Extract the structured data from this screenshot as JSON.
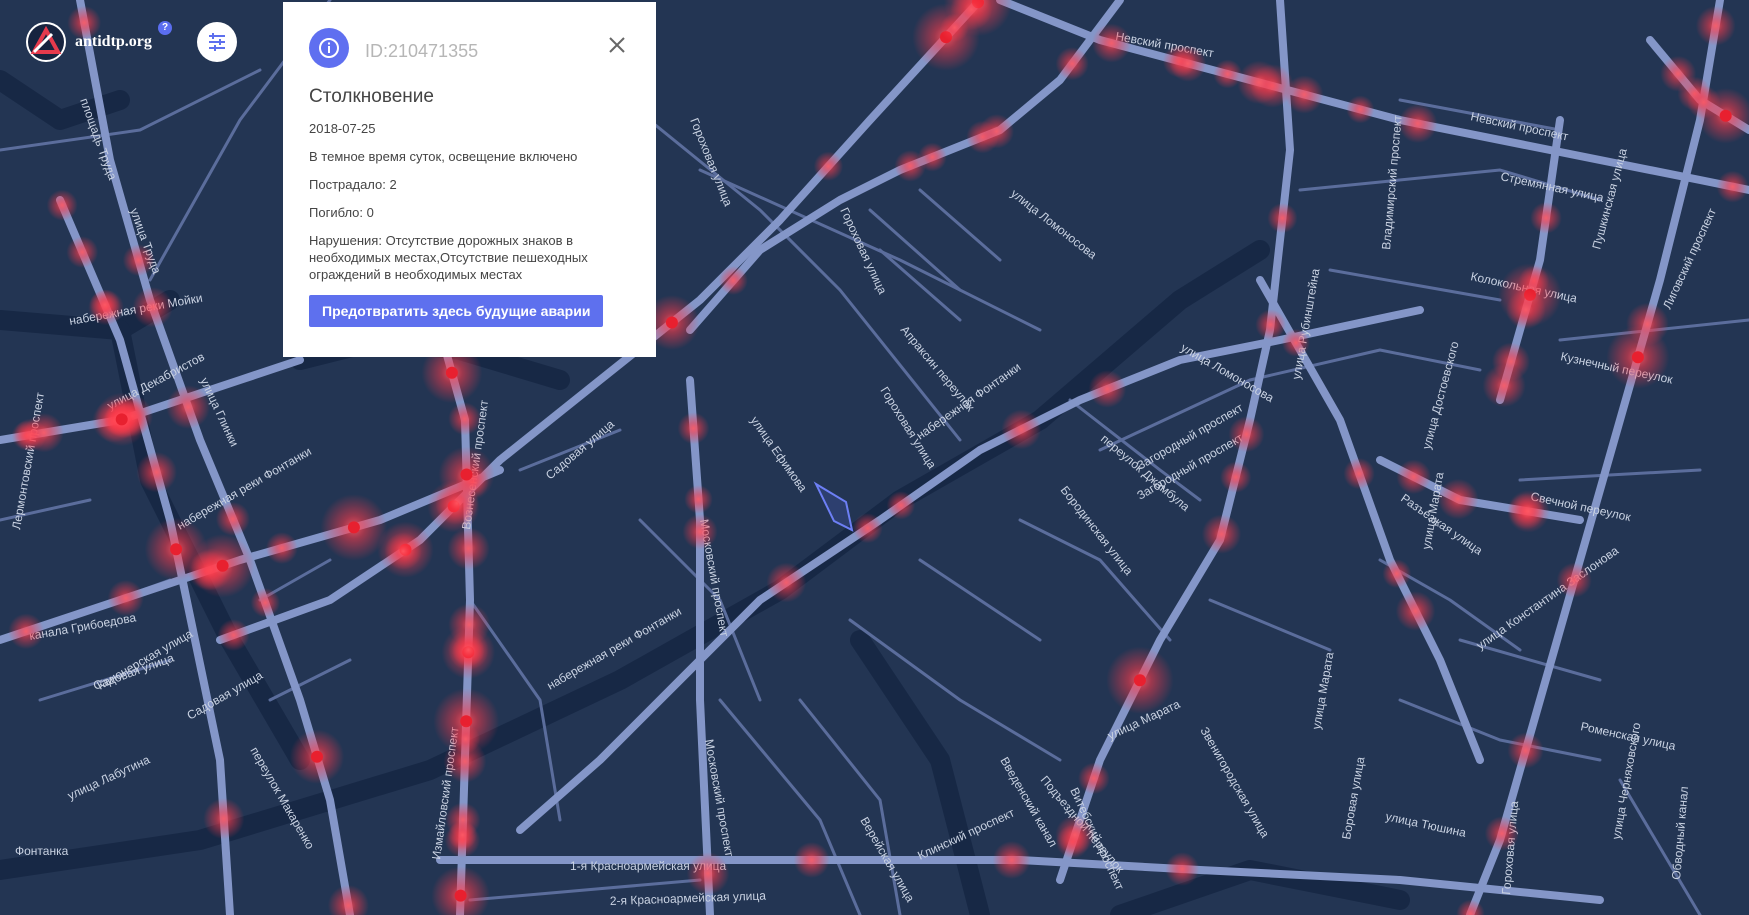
{
  "app": {
    "name": "antidtp.org",
    "help_symbol": "?"
  },
  "icons": {
    "logo": "triangle-logo-icon",
    "filter": "sliders-icon",
    "info": "info-icon",
    "close": "close-icon"
  },
  "popup": {
    "id_text": "ID:210471355",
    "title": "Столкновение",
    "date": "2018-07-25",
    "lighting": "В темное время суток, освещение включено",
    "injured": "Пострадало: 2",
    "killed": "Погибло: 0",
    "violations": "Нарушения: Отсутствие дорожных знаков в необходимых местах,Отсутствие пешеходных ограждений в необходимых местах",
    "action_label": "Предотвратить здесь будущие аварии"
  },
  "map": {
    "street_labels": [
      "Невский проспект",
      "Невский проспект",
      "набережная Фонтанки",
      "улица Ломоносова",
      "улица Ломоносова",
      "Стремянная улица",
      "Колокольная улица",
      "Кузнечный переулок",
      "Свечной переулок",
      "Разъезжая улица",
      "Загородный проспект",
      "Загородный проспект",
      "переулок Джамбула",
      "Бородинская улица",
      "Гороховая улица",
      "Гороховая улица",
      "Гороховая улица",
      "Апраксин переулок",
      "улица Ефимова",
      "Московский проспект",
      "Московский проспект",
      "Садовая улица",
      "Садовая улица",
      "Садовая улица",
      "Вознесенский проспект",
      "Измайловский проспект",
      "набережная реки Фонтанки",
      "набережная реки Фонтанки",
      "1-я Красноармейская улица",
      "2-я Красноармейская улица",
      "Введенский канал",
      "Верейская улица",
      "Клинский проспект",
      "Подъездной переулок",
      "Витебский проспект",
      "Звенигородская улица",
      "улица Марата",
      "улица Марата",
      "улица Марата",
      "улица Достоевского",
      "улица Рубинштейна",
      "Владимирский проспект",
      "Пушкинская улица",
      "Лиговский проспект",
      "улица Константина Заслонова",
      "Роменская улица",
      "улица Тюшина",
      "Боровая улица",
      "улица Черняховского",
      "Обводный канал",
      "площадь Труда",
      "улица Труда",
      "улица Глинки",
      "улица Декабристов",
      "Лермонтовский проспект",
      "канала Грибоедова",
      "Канонерская улица",
      "переулок Макаренко",
      "улица Лабутина",
      "Фонтанка",
      "набережная реки Мойки",
      "Гороховая улица"
    ],
    "accident_count": 120,
    "colors": {
      "background": "#233553",
      "major_road": "#8496c8",
      "minor_road": "#5b6d9c",
      "hotspot": "#ff3a4a"
    }
  }
}
